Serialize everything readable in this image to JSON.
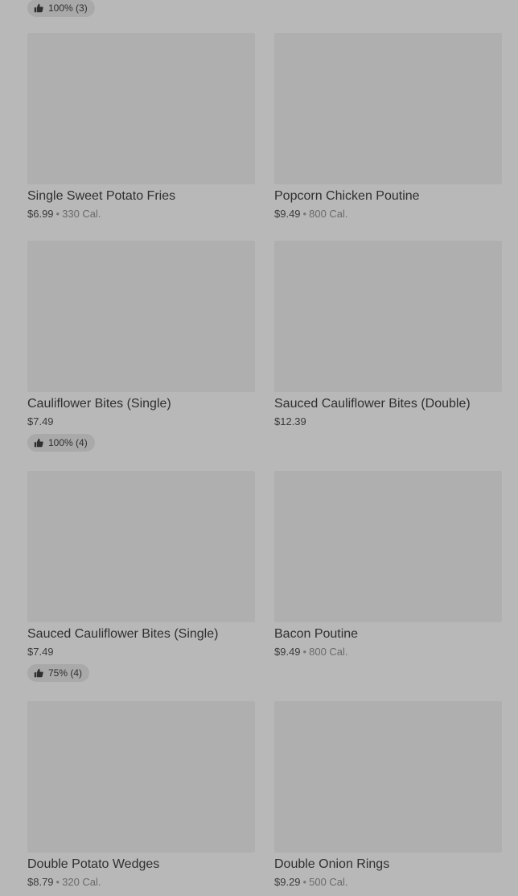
{
  "top_partial": {
    "rating_label": "100% (3)"
  },
  "items": [
    {
      "name": "Single Sweet Potato Fries",
      "price": "$6.99",
      "calories": "330 Cal.",
      "rating": ""
    },
    {
      "name": "Popcorn Chicken Poutine",
      "price": "$9.49",
      "calories": "800 Cal.",
      "rating": ""
    },
    {
      "name": "Cauliflower Bites (Single)",
      "price": "$7.49",
      "calories": "",
      "rating": "100% (4)"
    },
    {
      "name": "Sauced Cauliflower Bites (Double)",
      "price": "$12.39",
      "calories": "",
      "rating": ""
    },
    {
      "name": "Sauced Cauliflower Bites (Single)",
      "price": "$7.49",
      "calories": "",
      "rating": "75% (4)"
    },
    {
      "name": "Bacon Poutine",
      "price": "$9.49",
      "calories": "800 Cal.",
      "rating": ""
    },
    {
      "name": "Double Potato Wedges",
      "price": "$8.79",
      "calories": "320 Cal.",
      "rating": ""
    },
    {
      "name": "Double Onion Rings",
      "price": "$9.29",
      "calories": "500 Cal.",
      "rating": ""
    }
  ],
  "meta_separator": "•",
  "icons": {
    "rating": "thumbs-up-icon"
  },
  "colors": {
    "page_background": "#b8b8b8",
    "image_placeholder": "#afafaf",
    "badge_background": "#a9a9a9",
    "text_primary": "#2f2f2f"
  }
}
